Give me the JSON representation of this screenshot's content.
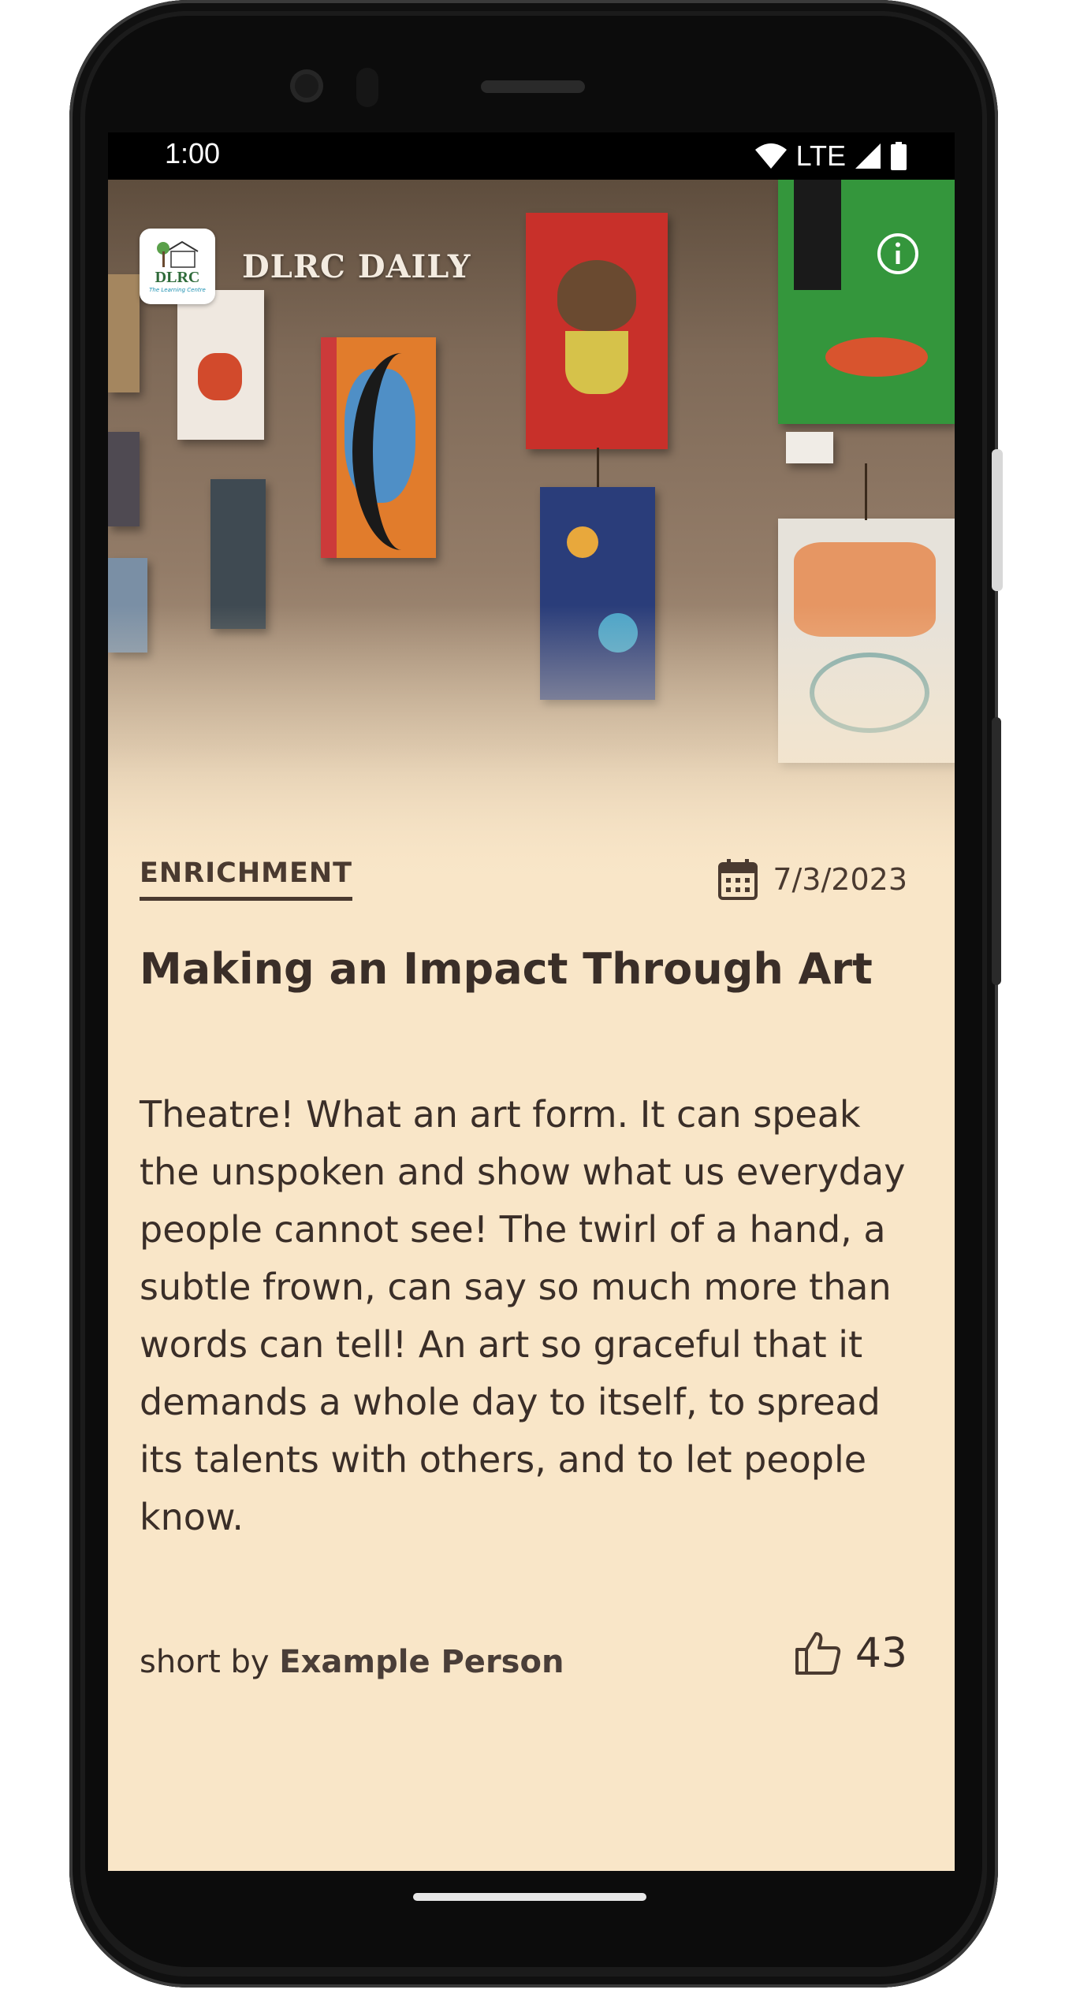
{
  "status_bar": {
    "time": "1:00",
    "network": "LTE",
    "icons": [
      "wifi-icon",
      "cell-signal-icon",
      "battery-icon"
    ]
  },
  "app_bar": {
    "logo_text": "DLRC",
    "logo_subtitle": "The Learning Centre",
    "title": "DLRC DAILY",
    "info_icon": "info-icon"
  },
  "article": {
    "category": "ENRICHMENT",
    "date": "7/3/2023",
    "title": "Making an Impact Through Art",
    "body": "Theatre! What an art form. It can speak the unspoken and show what us everyday people cannot see! The twirl of a hand, a subtle frown, can say so much more than words can tell! An art so graceful that it demands a whole day to itself, to spread its talents with others, and to let people know.",
    "byline_prefix": "short by",
    "author": "Example Person",
    "likes": "43"
  },
  "colors": {
    "background": "#f9e6c8",
    "text": "#3a2e28",
    "category": "#4a3a30"
  }
}
